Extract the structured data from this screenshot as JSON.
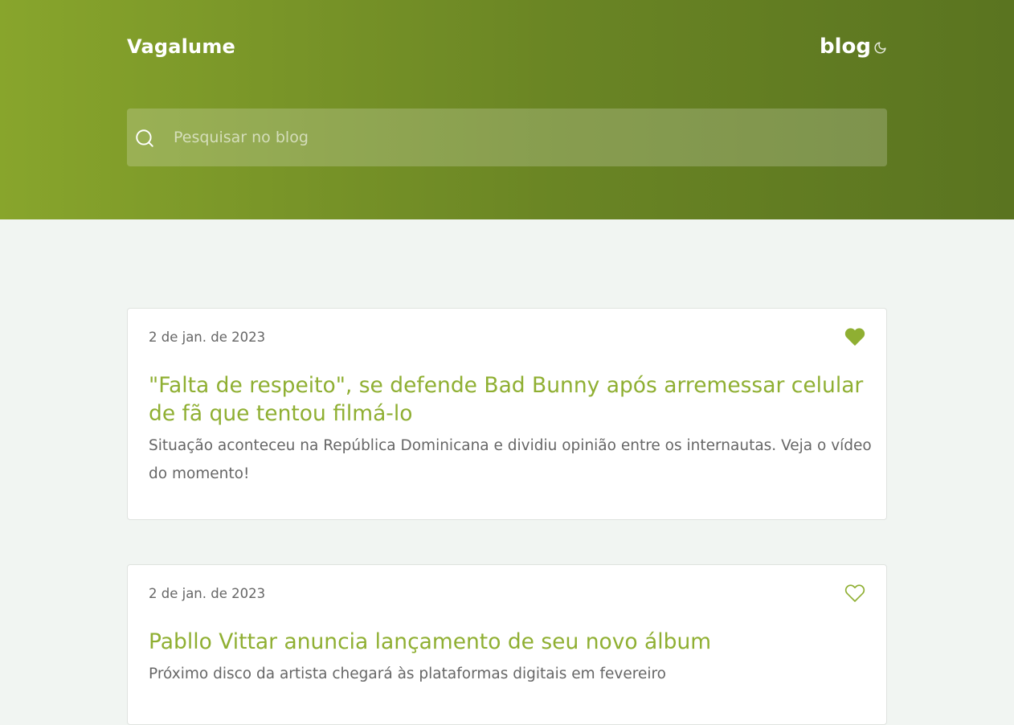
{
  "header": {
    "brand": "Vagalume",
    "nav_label": "blog",
    "theme_icon": "moon-icon"
  },
  "search": {
    "placeholder": "Pesquisar no blog",
    "value": "",
    "icon": "search-icon"
  },
  "colors": {
    "accent": "#8faf32",
    "hero_start": "#88a52c",
    "hero_end": "#5a7420",
    "page_bg": "#f1f5f2",
    "card_bg": "#ffffff",
    "text_muted": "#666666"
  },
  "posts": [
    {
      "date": "2 de jan. de 2023",
      "title": "\"Falta de respeito\", se defende Bad Bunny após arremessar celular de fã que tentou filmá-lo",
      "summary": "Situação aconteceu na República Dominicana e dividiu opinião entre os internautas. Veja o vídeo do momento!",
      "favorited": true,
      "fav_icon": "heart-filled-icon"
    },
    {
      "date": "2 de jan. de 2023",
      "title": "Pabllo Vittar anuncia lançamento de seu novo álbum",
      "summary": "Próximo disco da artista chegará às plataformas digitais em fevereiro",
      "favorited": false,
      "fav_icon": "heart-outline-icon"
    }
  ]
}
